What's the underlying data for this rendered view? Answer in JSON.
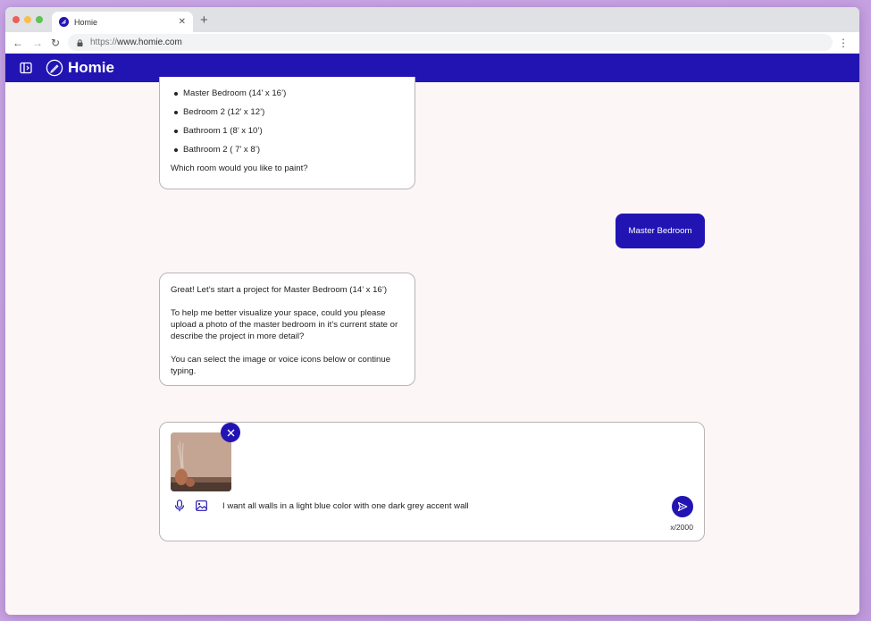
{
  "browser": {
    "tab_title": "Homie",
    "url_scheme": "https://",
    "url_host": "www.homie.com"
  },
  "app": {
    "brand": "Homie",
    "colors": {
      "primary": "#2214b3",
      "chat_bg": "#fdf6f6"
    }
  },
  "messages": {
    "bot1": {
      "rooms": [
        "Master Bedroom (14’ x 16’)",
        "Bedroom 2 (12’ x 12’)",
        "Bathroom 1 (8’ x 10’)",
        "Bathroom 2 ( 7’ x 8’)"
      ],
      "question": "Which room would you like to paint?"
    },
    "user1": "Master Bedroom",
    "bot2": {
      "p1": "Great! Let’s start a project for Master Bedroom (14’ x 16’)",
      "p2": "To help me better visualize your space, could you please upload a photo of the master bedroom in it’s current state or describe the project in more detail?",
      "p3": "You can select the image or voice icons below or continue typing."
    }
  },
  "composer": {
    "value": "I want all walls in a light blue color with one dark grey accent wall",
    "char_count": "x/2000"
  },
  "icons": [
    "sidebar-toggle-icon",
    "logo-icon",
    "mic-icon",
    "image-icon",
    "send-icon",
    "close-icon",
    "lock-icon"
  ]
}
